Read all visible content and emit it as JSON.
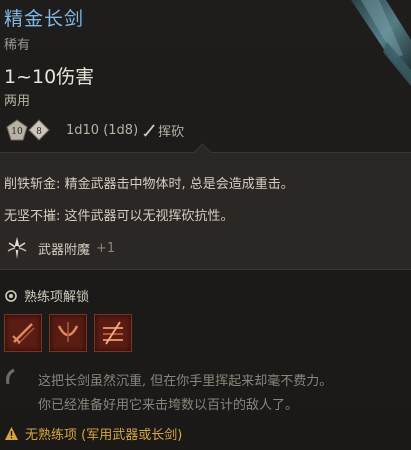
{
  "item": {
    "name": "精金长剑",
    "rarity": "稀有",
    "damage": "1~10伤害",
    "handedness": "两用"
  },
  "dice": {
    "die1": "10",
    "die2": "8",
    "roll": "1d10 (1d8)",
    "damage_type": "挥砍"
  },
  "properties": {
    "line1": "削铁斩金: 精金武器击中物体时, 总是会造成重击。",
    "line2": "无坚不摧: 这件武器可以无视挥砍抗性。",
    "enchant_label": "武器附魔",
    "enchant_bonus": "+1"
  },
  "proficiency": {
    "title": "熟练项解锁",
    "skills": [
      "skill-1",
      "skill-2",
      "skill-3"
    ]
  },
  "description": {
    "line1": "这把长剑虽然沉重, 但在你手里挥起来却毫不费力。",
    "line2": "你已经准备好用它来击垮数以百计的敌人了。"
  },
  "warning": {
    "text": "无熟练项 (军用武器或长剑)"
  },
  "colors": {
    "name": "#7fb7e6",
    "warning": "#d6a640",
    "skill_bg": "#5a1d14"
  }
}
